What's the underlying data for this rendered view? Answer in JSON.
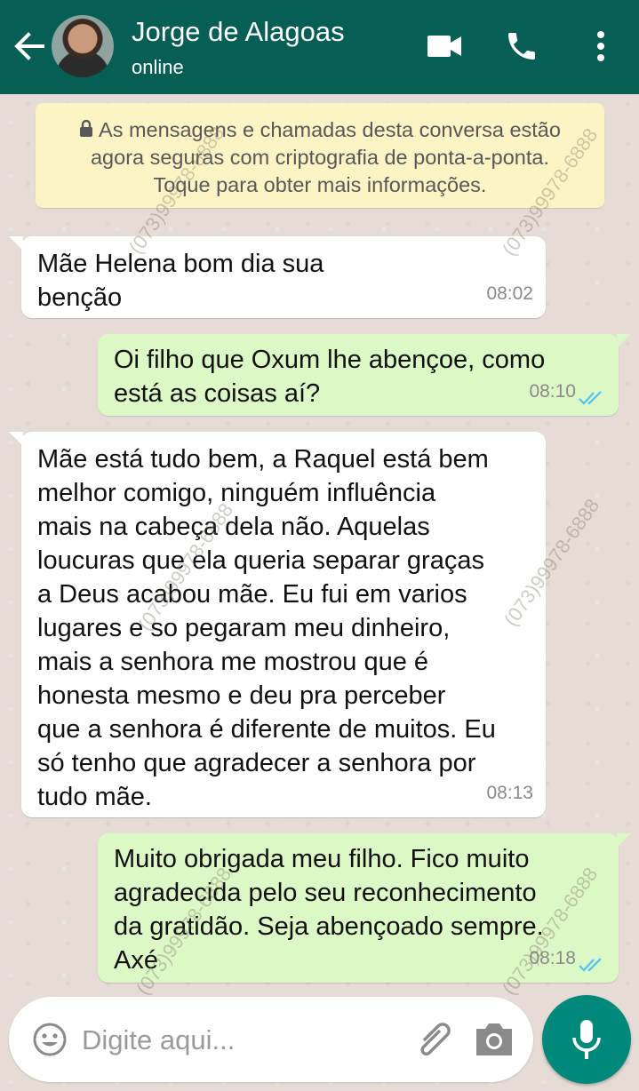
{
  "header": {
    "contact_name": "Jorge de Alagoas",
    "status": "online",
    "icons": [
      "back-arrow-icon",
      "video-call-icon",
      "phone-icon",
      "more-vertical-icon"
    ],
    "color": "#075e54"
  },
  "notice": {
    "line1": "As mensagens e chamadas desta conversa estão",
    "line2": "agora seguras com criptografia de ponta-a-ponta.",
    "line3": "Toque para obter mais informações."
  },
  "messages": [
    {
      "direction": "in",
      "text": "Mãe Helena bom dia sua\nbenção",
      "time": "08:02"
    },
    {
      "direction": "out",
      "text": "Oi filho que Oxum lhe abençoe, como\nestá as coisas aí?",
      "time": "08:10",
      "status": "read"
    },
    {
      "direction": "in",
      "text": "Mãe está tudo bem, a Raquel está bem\nmelhor comigo, ninguém influência\nmais na cabeça dela não. Aquelas\nloucuras que ela queria separar graças\na Deus acabou mãe. Eu fui em varios\nlugares e so pegaram meu dinheiro,\nmais a senhora me mostrou que é\nhonesta mesmo e deu pra perceber\nque a senhora é diferente de muitos. Eu\nsó tenho que agradecer a senhora por\ntudo mãe.",
      "time": "08:13"
    },
    {
      "direction": "out",
      "text": "Muito obrigada meu filho. Fico muito\nagradecida pelo seu reconhecimento\nda gratidão. Seja abençoado sempre.\nAxé",
      "time": "08:18",
      "status": "read"
    }
  ],
  "composer": {
    "placeholder": "Digite aqui...",
    "icons": [
      "emoji-icon",
      "attach-icon",
      "camera-icon",
      "mic-icon"
    ],
    "send_color": "#00897b"
  },
  "watermark": "(073)99978-6888"
}
